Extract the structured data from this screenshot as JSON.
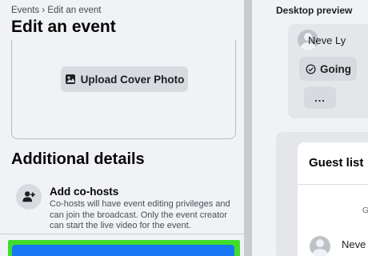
{
  "left": {
    "breadcrumb": "Events › Edit an event",
    "title": "Edit an event",
    "upload_label": "Upload Cover Photo",
    "section_title": "Additional details",
    "cohosts": {
      "title": "Add co-hosts",
      "description": "Co-hosts will have event editing privileges and can join the broadcast. Only the event creator can start the live video for the event."
    }
  },
  "right": {
    "preview_label": "Desktop preview",
    "host_name": "Neve Ly",
    "going_label": "Going",
    "more_label": "...",
    "guest_title": "Guest list",
    "guest_letter": "G",
    "guest_name": "Neve"
  },
  "colors": {
    "accent": "#1877f2",
    "highlight": "#3fdc2c"
  },
  "icons": {
    "upload": "photo-icon",
    "cohosts": "add-person-icon",
    "going": "check-circle-icon"
  }
}
